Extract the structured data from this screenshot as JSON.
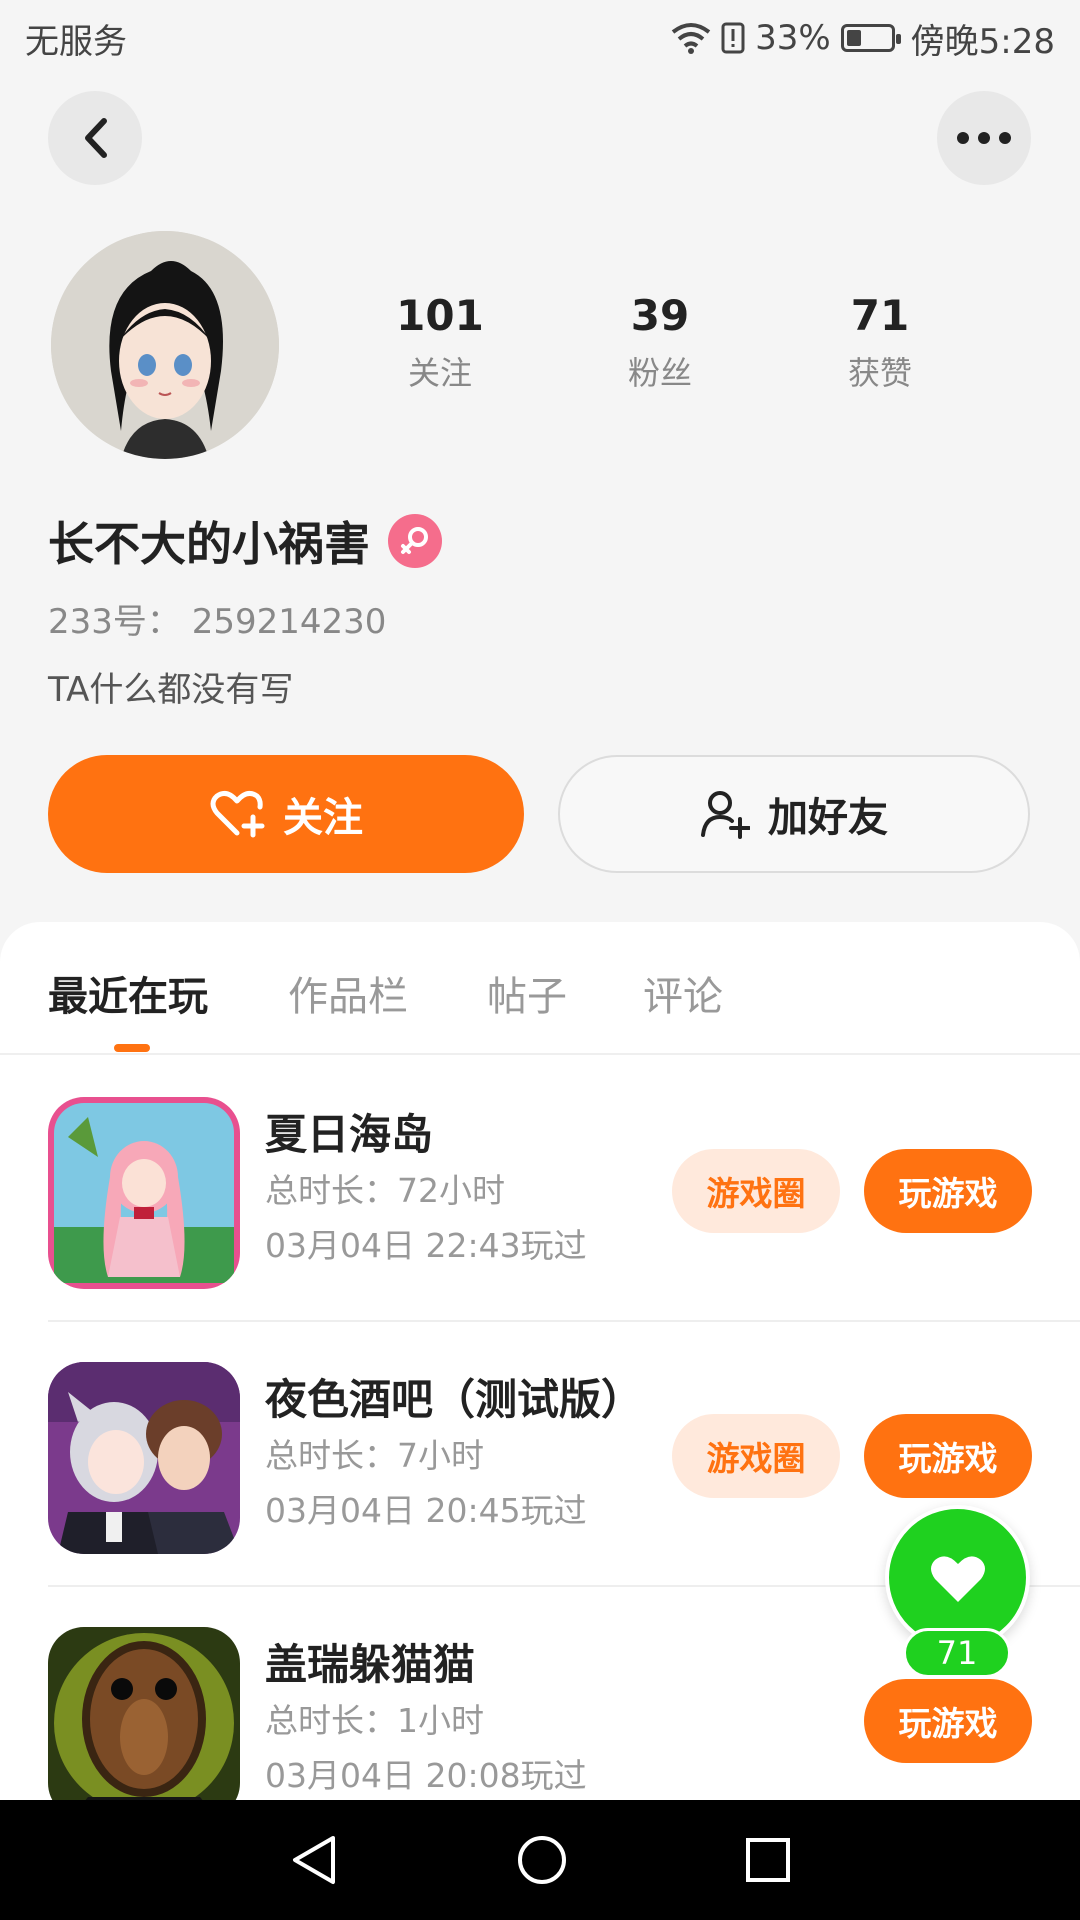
{
  "status_bar": {
    "carrier": "无服务",
    "battery_percent_text": "33%",
    "battery_level": 0.33,
    "time": "傍晚5:28"
  },
  "profile": {
    "username": "长不大的小祸害",
    "user_id": "233号： 259214230",
    "bio": "TA什么都没有写",
    "stats": [
      {
        "value": "101",
        "label": "关注"
      },
      {
        "value": "39",
        "label": "粉丝"
      },
      {
        "value": "71",
        "label": "获赞"
      }
    ]
  },
  "actions": {
    "follow_label": "关注",
    "add_friend_label": "加好友"
  },
  "tabs": [
    {
      "label": "最近在玩",
      "active": true
    },
    {
      "label": "作品栏",
      "active": false
    },
    {
      "label": "帖子",
      "active": false
    },
    {
      "label": "评论",
      "active": false
    }
  ],
  "games": [
    {
      "title": "夏日海岛",
      "duration": "总时长：72小时",
      "last_played": "03月04日 22:43玩过",
      "circle_label": "游戏圈",
      "play_label": "玩游戏"
    },
    {
      "title": "夜色酒吧（测试版）",
      "duration": "总时长：7小时",
      "last_played": "03月04日 20:45玩过",
      "circle_label": "游戏圈",
      "play_label": "玩游戏"
    },
    {
      "title": "盖瑞躲猫猫",
      "duration": "总时长：1小时",
      "last_played": "03月04日 20:08玩过",
      "circle_label": "",
      "play_label": "玩游戏"
    }
  ],
  "like_fab": {
    "count": "71"
  },
  "colors": {
    "accent": "#ff7211",
    "like_green": "#1fd11f",
    "gender_pink": "#f56d8c"
  }
}
